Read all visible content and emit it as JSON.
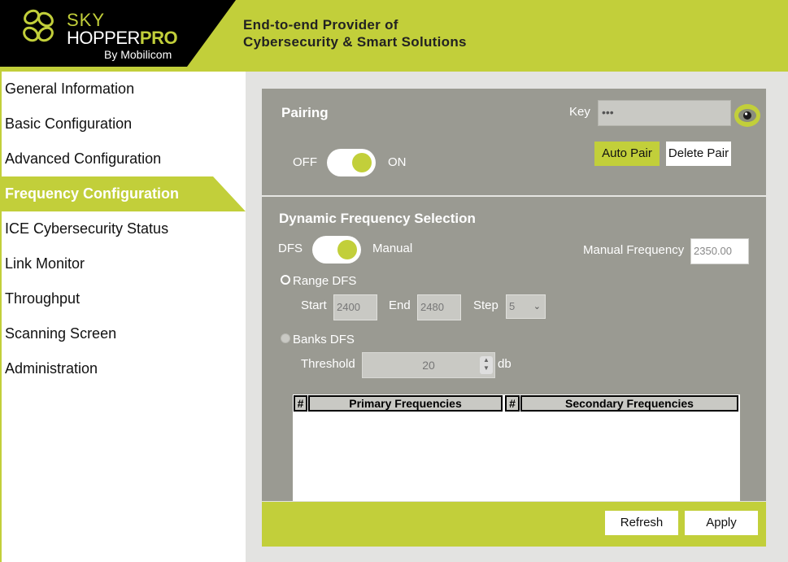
{
  "header": {
    "logo_sky": "SKY",
    "logo_hopper": "HOPPER",
    "logo_pro": "PRO",
    "logo_by": "By Mobilicom",
    "tagline_line1": "End-to-end Provider of",
    "tagline_line2": "Cybersecurity & Smart Solutions"
  },
  "sidebar": {
    "items": [
      {
        "label": "General Information"
      },
      {
        "label": "Basic Configuration"
      },
      {
        "label": "Advanced Configuration"
      },
      {
        "label": "Frequency Configuration",
        "active": true
      },
      {
        "label": "ICE Cybersecurity Status"
      },
      {
        "label": "Link Monitor"
      },
      {
        "label": "Throughput"
      },
      {
        "label": "Scanning Screen"
      },
      {
        "label": "Administration"
      }
    ]
  },
  "pairing": {
    "title": "Pairing",
    "key_label": "Key",
    "key_value": "•••",
    "off_label": "OFF",
    "on_label": "ON",
    "toggle_on": true,
    "auto_pair_label": "Auto Pair",
    "delete_pair_label": "Delete Pair"
  },
  "dfs": {
    "title": "Dynamic Frequency Selection",
    "dfs_label": "DFS",
    "manual_label": "Manual",
    "toggle_manual": true,
    "manual_frequency_label": "Manual Frequency",
    "manual_frequency_value": "2350.00",
    "range_dfs_label": "Range DFS",
    "start_label": "Start",
    "start_value": "2400",
    "end_label": "End",
    "end_value": "2480",
    "step_label": "Step",
    "step_value": "5",
    "banks_dfs_label": "Banks DFS",
    "threshold_label": "Threshold",
    "threshold_value": "20",
    "threshold_unit": "db"
  },
  "freq_table": {
    "col_hash_1": "#",
    "col_primary": "Primary Frequencies",
    "col_hash_2": "#",
    "col_secondary": "Secondary Frequencies"
  },
  "footer": {
    "refresh_label": "Refresh",
    "apply_label": "Apply"
  },
  "colors": {
    "accent": "#c2cf3a",
    "panel": "#9a9a92",
    "logo_bg": "#000000"
  },
  "icons": {
    "eye": "eye-icon",
    "logo": "logo-rings-icon",
    "dropdown": "chevron-down-icon"
  }
}
